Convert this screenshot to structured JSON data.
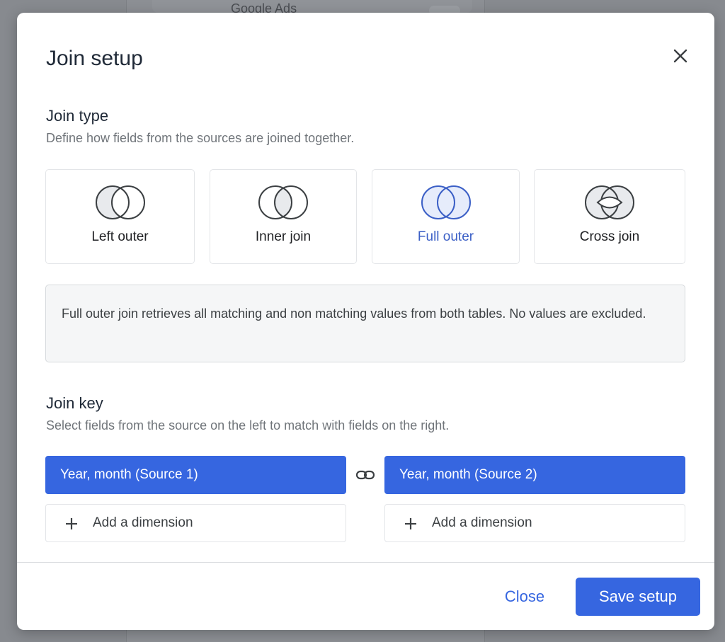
{
  "background": {
    "peek_text": "Google Ads"
  },
  "modal": {
    "title": "Join setup",
    "close_icon": "close-icon"
  },
  "join_type": {
    "title": "Join type",
    "subtitle": "Define how fields from the sources are joined together.",
    "options": [
      {
        "label": "Left outer",
        "icon": "venn-left-outer-icon",
        "selected": false
      },
      {
        "label": "Inner join",
        "icon": "venn-inner-join-icon",
        "selected": false
      },
      {
        "label": "Full outer",
        "icon": "venn-full-outer-icon",
        "selected": true
      },
      {
        "label": "Cross join",
        "icon": "venn-cross-join-icon",
        "selected": false
      }
    ],
    "description": "Full outer join retrieves all matching and non matching values from both tables. No values are excluded."
  },
  "join_key": {
    "title": "Join key",
    "subtitle": "Select fields from the source on the left to match with fields on the right.",
    "left_key": "Year, month (Source 1)",
    "right_key": "Year, month (Source 2)",
    "link_icon": "link-icon",
    "add_dimension_label": "Add a dimension"
  },
  "footer": {
    "close_label": "Close",
    "save_label": "Save setup"
  },
  "colors": {
    "accent": "#3666e0",
    "selected_text": "#3b5fc6",
    "venn_fill": "#e8eaed",
    "venn_selected_fill": "#e6ecfb",
    "backdrop": "#878a8f"
  }
}
